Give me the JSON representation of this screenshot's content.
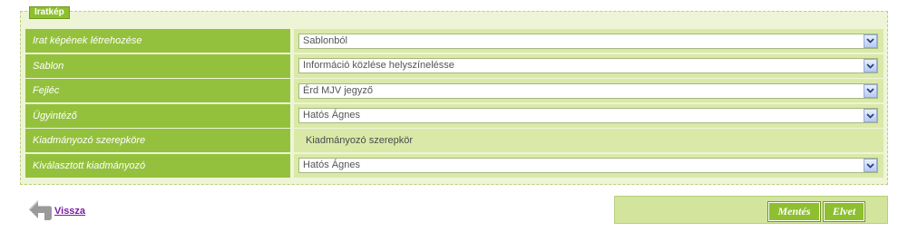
{
  "section": {
    "legend": "Iratkép"
  },
  "form": {
    "rows": [
      {
        "label": "Irat képének létrehozése",
        "value": "Sablonból",
        "type": "select"
      },
      {
        "label": "Sablon",
        "value": "Információ közlése helyszínelésse",
        "type": "select"
      },
      {
        "label": "Fejléc",
        "value": "Érd MJV jegyző",
        "type": "select"
      },
      {
        "label": "Ügyintéző",
        "value": "Hatós Ágnes",
        "type": "select"
      },
      {
        "label": "Kiadmányozó szerepköre",
        "value": "Kiadmányozó szerepkör",
        "type": "static"
      },
      {
        "label": "Kiválasztott kiadmányozó",
        "value": "Hatós Ágnes",
        "type": "select"
      }
    ]
  },
  "nav": {
    "back_label": "Vissza",
    "back_icon": "back-arrow-icon"
  },
  "actions": {
    "save_label": "Mentés",
    "reject_label": "Elvet"
  },
  "colors": {
    "accent": "#94c13d",
    "panel": "#eef5d6",
    "value_bg": "#dbe9a8",
    "link": "#7b1ea2"
  }
}
